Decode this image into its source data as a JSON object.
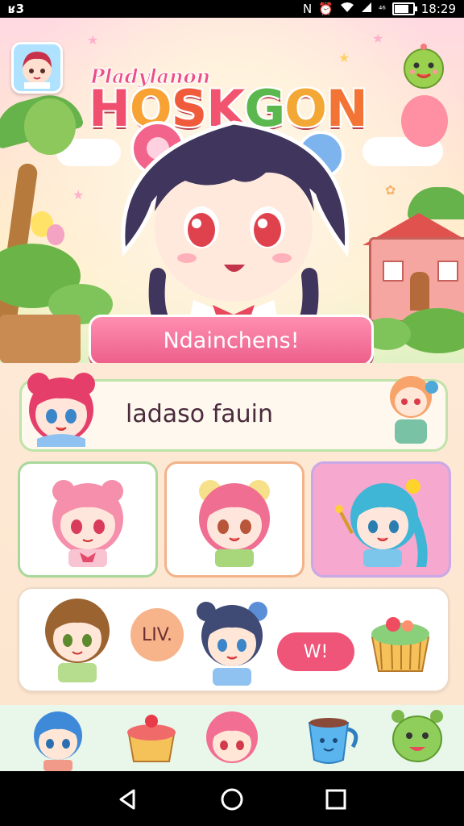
{
  "status_bar": {
    "left_icon_text": "ʁ3",
    "time": "18:29",
    "signal_text": "⁴⁶"
  },
  "header": {
    "logo_subtitle": "Pladylanon",
    "logo_title_letters": [
      "H",
      "O",
      "S",
      "K",
      "G",
      "O",
      "N"
    ],
    "logo_letter_colors": [
      "#f0506e",
      "#f7a233",
      "#f05c3b",
      "#f2536f",
      "#5ab84e",
      "#f3a734",
      "#f37434"
    ]
  },
  "hero": {
    "welcome_button_label": "Ndainchens!"
  },
  "profile": {
    "name_text": "ladaso fauin"
  },
  "friends_panel": {
    "level_badge_label": "LIV.",
    "action_button_label": "W!"
  },
  "icons": {
    "status_left": "carrier-icon",
    "nfc": "nfc-icon",
    "alarm": "alarm-icon",
    "wifi": "wifi-icon",
    "battery": "battery-icon",
    "back": "back-icon",
    "home": "home-icon",
    "recents": "recents-icon"
  },
  "colors": {
    "accent_pink": "#ec5f8b",
    "card_green": "#a8d89a",
    "card_orange": "#f2b38a",
    "card_purple": "#c9a8e8",
    "dock_bg": "#e9f7ea"
  }
}
